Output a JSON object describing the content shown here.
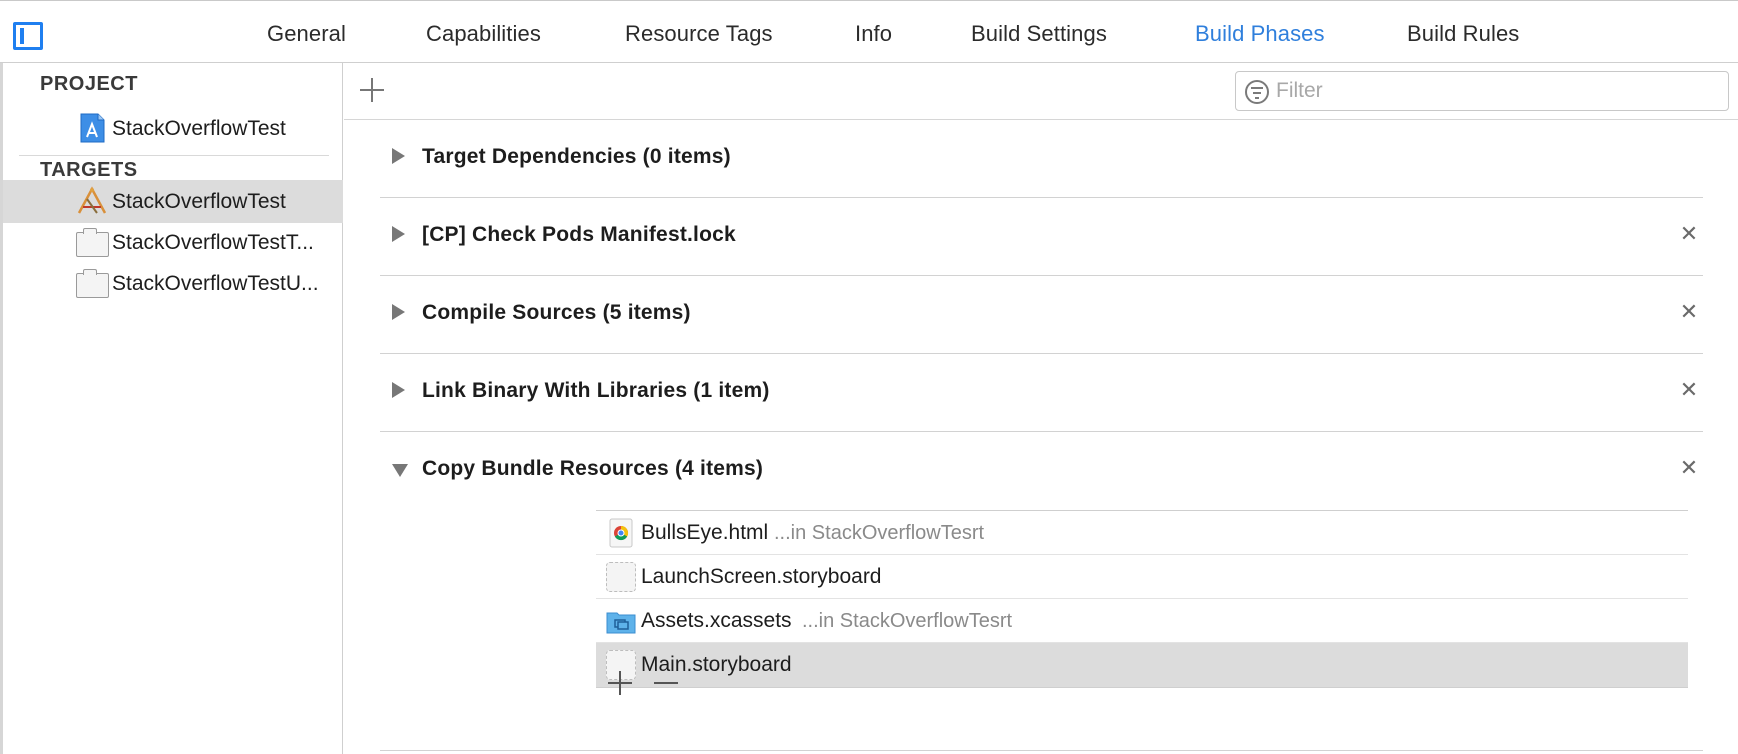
{
  "tabs": {
    "general": "General",
    "capabilities": "Capabilities",
    "resource_tags": "Resource Tags",
    "info": "Info",
    "build_settings": "Build Settings",
    "build_phases": "Build Phases",
    "build_rules": "Build Rules",
    "active": "Build Phases"
  },
  "sidebar": {
    "project_header": "PROJECT",
    "project_item": "StackOverflowTest",
    "targets_header": "TARGETS",
    "targets": [
      "StackOverflowTest",
      "StackOverflowTestT...",
      "StackOverflowTestU..."
    ],
    "selected_target": "StackOverflowTest"
  },
  "toolbar": {
    "filter_placeholder": "Filter"
  },
  "phases": [
    {
      "title": "Target Dependencies (0 items)",
      "expanded": false,
      "removable": false
    },
    {
      "title": "[CP] Check Pods Manifest.lock",
      "expanded": false,
      "removable": true
    },
    {
      "title": "Compile Sources (5 items)",
      "expanded": false,
      "removable": true
    },
    {
      "title": "Link Binary With Libraries (1 item)",
      "expanded": false,
      "removable": true
    },
    {
      "title": "Copy Bundle Resources (4 items)",
      "expanded": true,
      "removable": true
    }
  ],
  "close_glyph": "✕",
  "resources": [
    {
      "name": "BullsEye.html",
      "location": "...in StackOverflowTesrt",
      "icon": "html-file-icon"
    },
    {
      "name": "LaunchScreen.storyboard",
      "location": "",
      "icon": "storyboard-file-icon"
    },
    {
      "name": "Assets.xcassets",
      "location": "...in StackOverflowTesrt",
      "icon": "asset-catalog-icon"
    },
    {
      "name": "Main.storyboard",
      "location": "",
      "icon": "storyboard-file-icon",
      "selected": true
    }
  ],
  "colors": {
    "accent": "#2f7fdc",
    "toggle": "#1f7ff0",
    "selection": "#dcdcdc"
  }
}
